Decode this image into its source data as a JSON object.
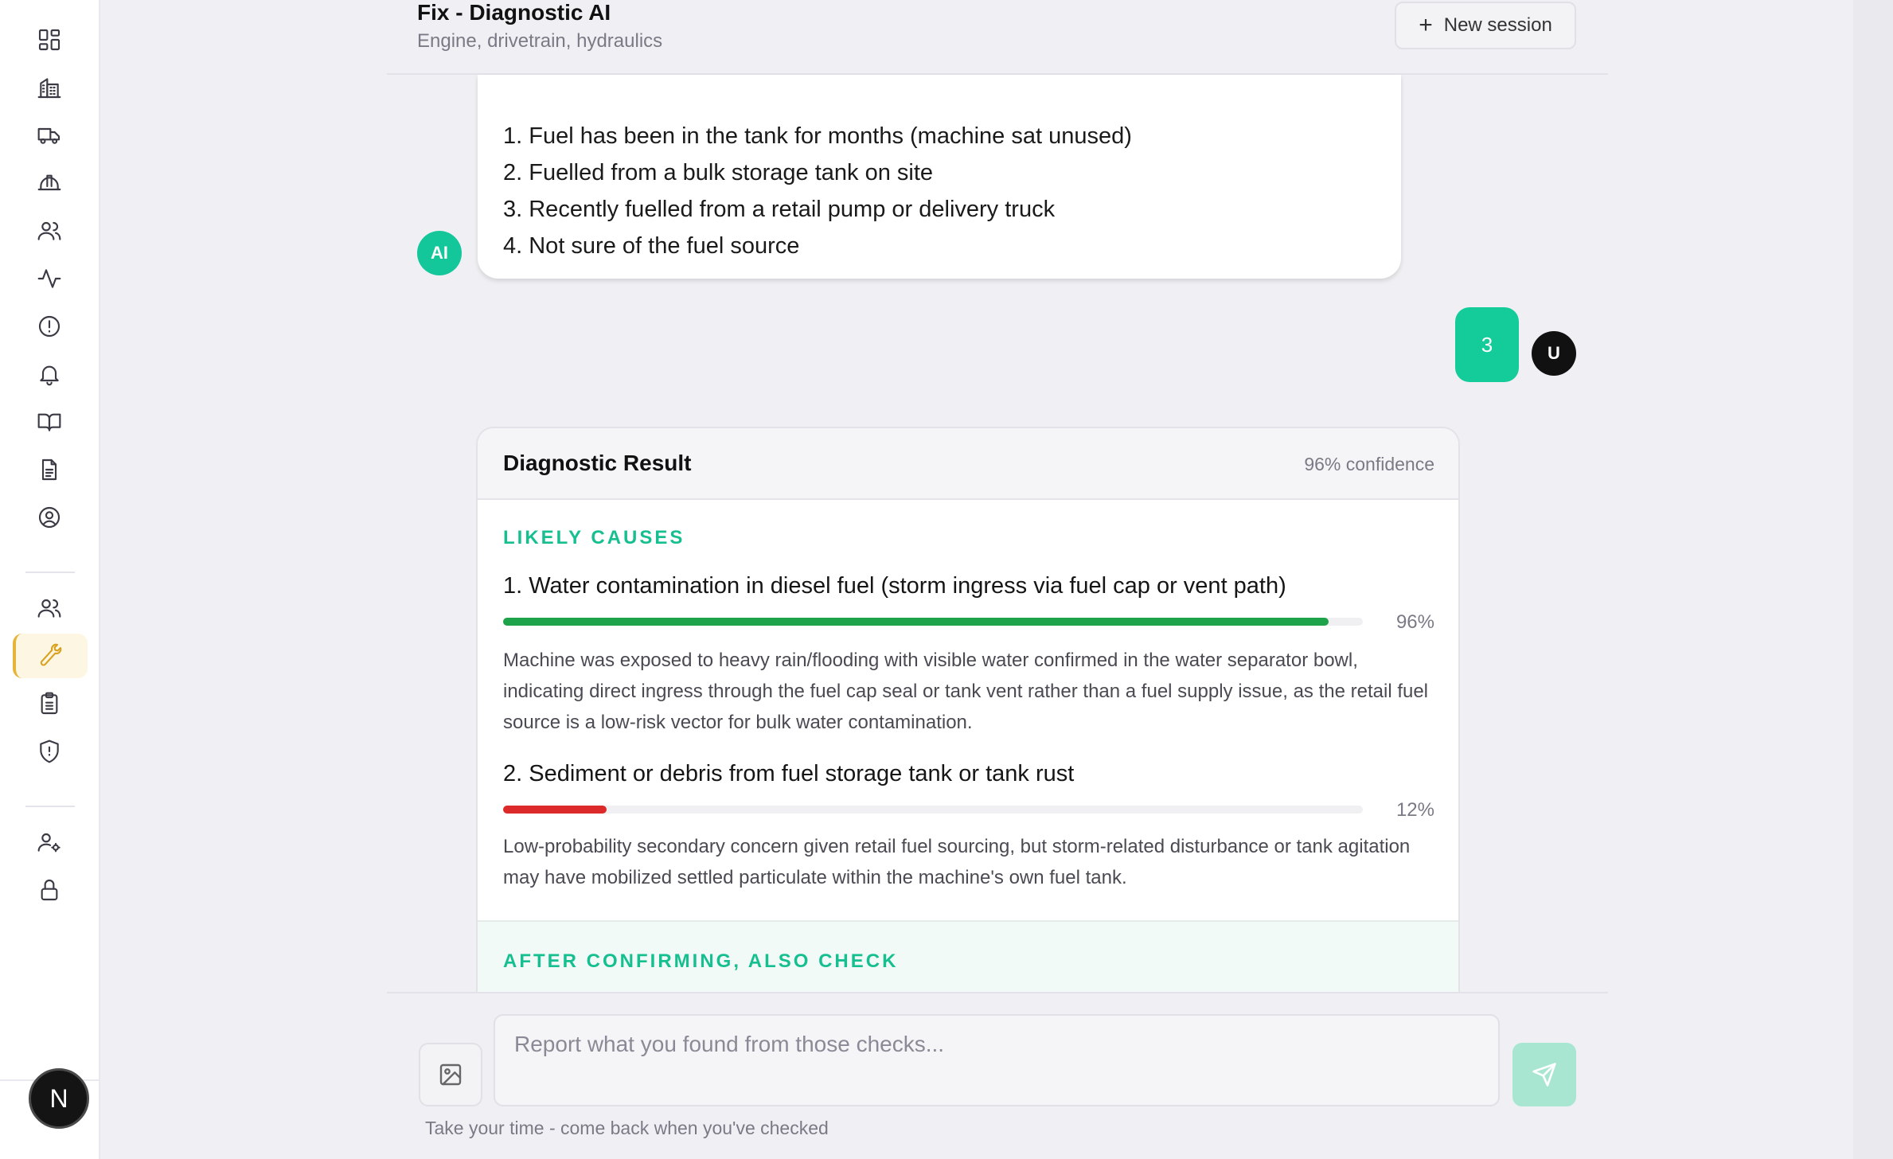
{
  "header": {
    "title": "Fix - Diagnostic AI",
    "subtitle": "Engine, drivetrain, hydraulics",
    "new_session_label": "New session"
  },
  "sidebar": {
    "icons": [
      "dashboard-icon",
      "building-icon",
      "truck-icon",
      "hard-hat-icon",
      "users-icon",
      "activity-icon",
      "alert-circle-icon",
      "bell-icon",
      "book-open-icon",
      "file-text-icon",
      "user-circle-icon",
      "team-icon",
      "wrench-icon",
      "clipboard-icon",
      "shield-alert-icon",
      "user-settings-icon",
      "lock-icon"
    ],
    "active_item": "wrench-icon",
    "avatar_initial": "N",
    "accent_color": "#e7b43a"
  },
  "conversation": {
    "ai_avatar": "AI",
    "ai_options": [
      "1. Fuel has been in the tank for months (machine sat unused)",
      "2. Fuelled from a bulk storage tank on site",
      "3. Recently fuelled from a retail pump or delivery truck",
      "4. Not sure of the fuel source"
    ],
    "user_avatar": "U",
    "user_reply": "3"
  },
  "result": {
    "title": "Diagnostic Result",
    "confidence": "96% confidence",
    "likely_causes_label": "LIKELY CAUSES",
    "causes": [
      {
        "title": "1. Water contamination in diesel fuel (storm ingress via fuel cap or vent path)",
        "probability": 96,
        "probability_label": "96%",
        "color": "#1ea24a",
        "description": "Machine was exposed to heavy rain/flooding with visible water confirmed in the water separator bowl, indicating direct ingress through the fuel cap seal or tank vent rather than a fuel supply issue, as the retail fuel source is a low-risk vector for bulk water contamination."
      },
      {
        "title": "2. Sediment or debris from fuel storage tank or tank rust",
        "probability": 12,
        "probability_label": "12%",
        "color": "#dc2a2a",
        "description": "Low-probability secondary concern given retail fuel sourcing, but storm-related disturbance or tank agitation may have mobilized settled particulate within the machine's own fuel tank."
      }
    ],
    "after_label": "AFTER CONFIRMING, ALSO CHECK"
  },
  "composer": {
    "placeholder": "Report what you found from those checks...",
    "value": "",
    "hint": "Take your time - come back when you've checked"
  },
  "colors": {
    "brand_green": "#14c79a",
    "send_disabled": "#a8e6d2",
    "background": "#f0f0f4"
  }
}
